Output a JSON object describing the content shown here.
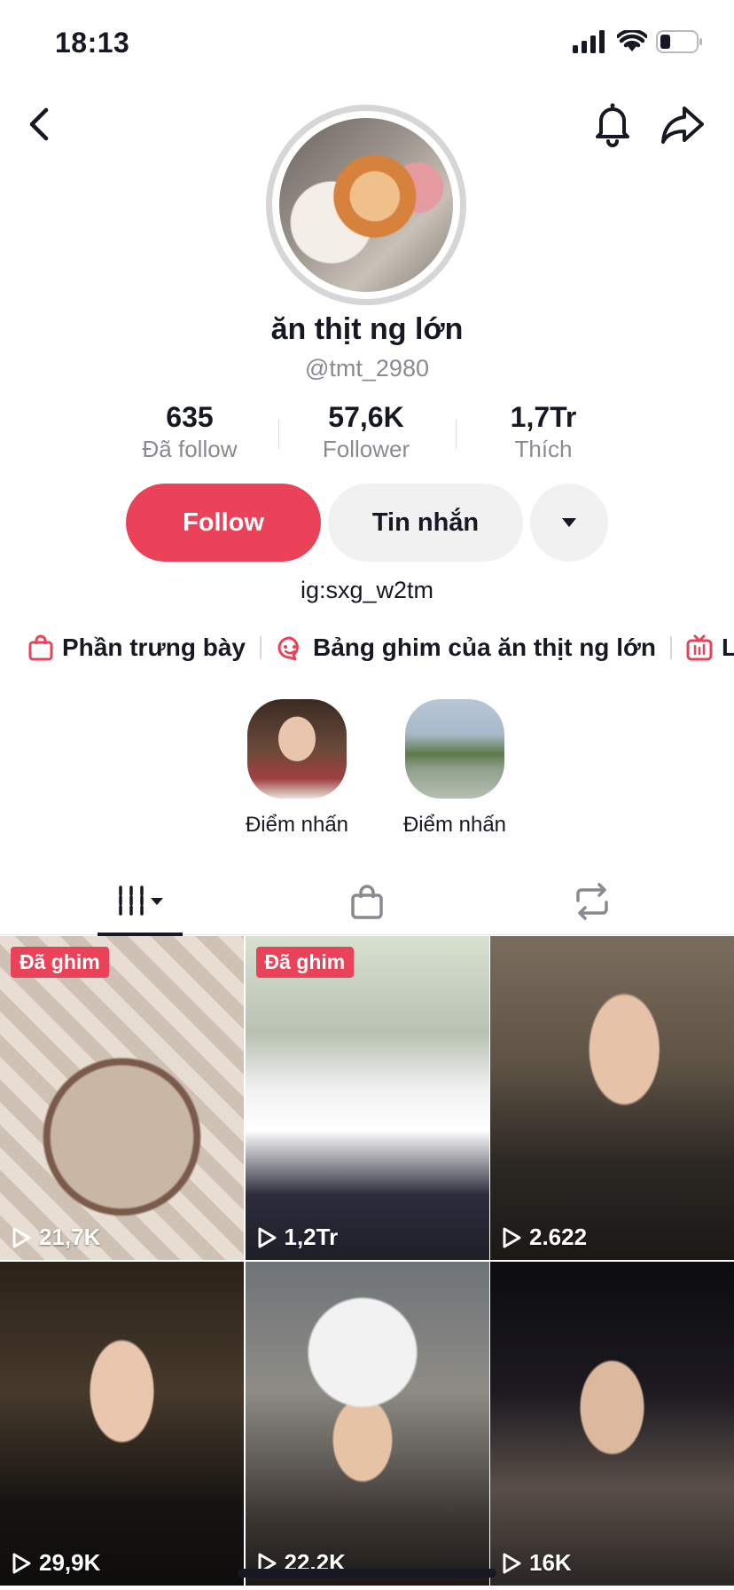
{
  "status_bar": {
    "time": "18:13"
  },
  "profile": {
    "display_name": "ăn thịt ng lớn",
    "username": "@tmt_2980",
    "bio": "ig:sxg_w2tm"
  },
  "stats": [
    {
      "value": "635",
      "label": "Đã follow"
    },
    {
      "value": "57,6K",
      "label": "Follower"
    },
    {
      "value": "1,7Tr",
      "label": "Thích"
    }
  ],
  "actions": {
    "follow": "Follow",
    "message": "Tin nhắn"
  },
  "links": [
    {
      "label": "Phần trưng bày",
      "icon": "shopping-bag-icon"
    },
    {
      "label": "Bảng ghim của ăn thịt ng lớn",
      "icon": "pin-board-icon"
    },
    {
      "label": "LI",
      "icon": "live-tv-icon"
    }
  ],
  "highlights": [
    {
      "label": "Điểm nhấn"
    },
    {
      "label": "Điểm nhấn"
    }
  ],
  "tabs": [
    {
      "name": "videos-grid",
      "icon": "grid-bars-icon",
      "active": true
    },
    {
      "name": "shop",
      "icon": "shopping-bag-icon",
      "active": false
    },
    {
      "name": "reposts",
      "icon": "repost-icon",
      "active": false
    }
  ],
  "videos": [
    {
      "views": "21,7K",
      "pinned": true,
      "pin_label": "Đã ghim"
    },
    {
      "views": "1,2Tr",
      "pinned": true,
      "pin_label": "Đã ghim"
    },
    {
      "views": "2.622",
      "pinned": false
    },
    {
      "views": "29,9K",
      "pinned": false
    },
    {
      "views": "22,2K",
      "pinned": false
    },
    {
      "views": "16K",
      "pinned": false
    }
  ],
  "colors": {
    "accent": "#ea4359",
    "secondary_bg": "#f1f1f2",
    "muted_text": "#8a8b91"
  }
}
